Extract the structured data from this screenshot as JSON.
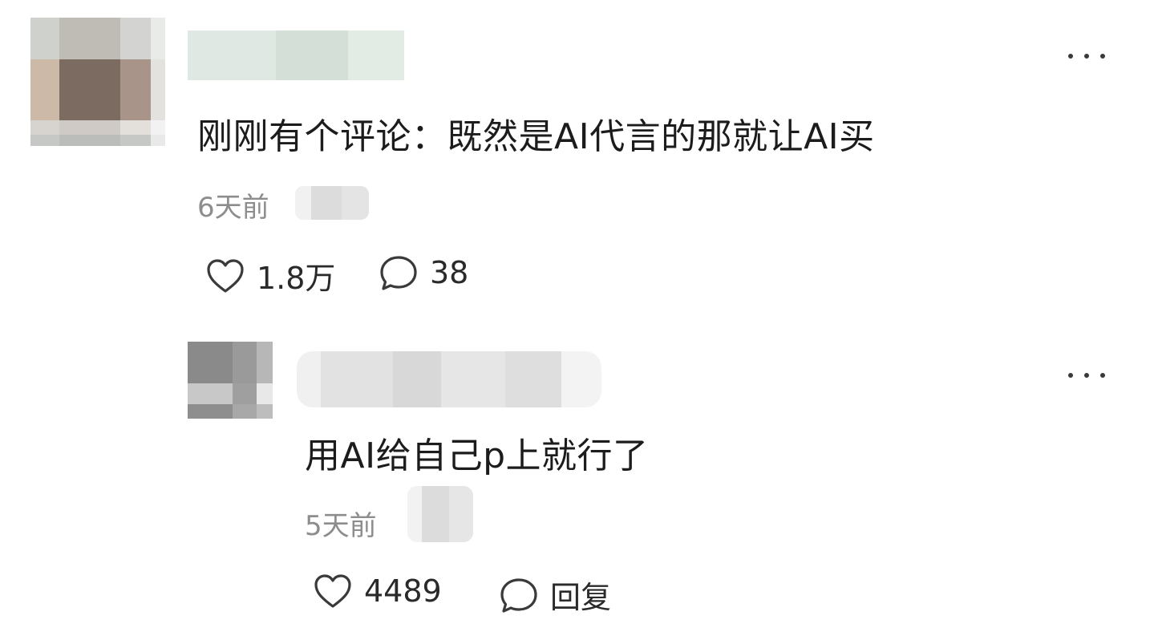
{
  "comments": [
    {
      "text": "刚刚有个评论：既然是AI代言的那就让AI买",
      "time": "6天前",
      "likes": "1.8万",
      "replies": "38",
      "like_icon": "heart-outline-icon",
      "reply_icon": "speech-bubble-icon",
      "more_icon": "more-horizontal-icon"
    },
    {
      "text": "用AI给自己p上就行了",
      "time": "5天前",
      "likes": "4489",
      "reply_label": "回复",
      "like_icon": "heart-outline-icon",
      "reply_icon": "speech-bubble-icon",
      "more_icon": "more-horizontal-icon"
    }
  ],
  "colors": {
    "text": "#1c1c1c",
    "meta": "#8d8d8d",
    "background": "#ffffff"
  }
}
